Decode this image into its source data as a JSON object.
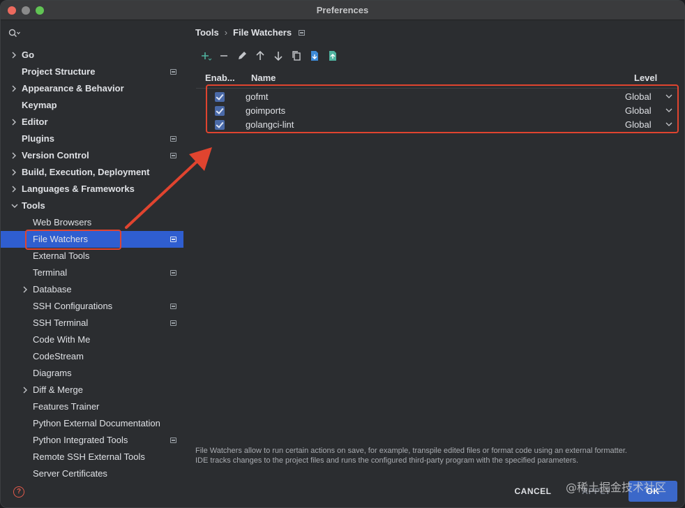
{
  "window": {
    "title": "Preferences"
  },
  "sidebar": {
    "search_placeholder": "",
    "items": [
      {
        "label": "Go",
        "bold": true,
        "level": 0,
        "expander": "right",
        "project": false
      },
      {
        "label": "Project Structure",
        "bold": true,
        "level": 0,
        "expander": "none",
        "project": true
      },
      {
        "label": "Appearance & Behavior",
        "bold": true,
        "level": 0,
        "expander": "right",
        "project": false
      },
      {
        "label": "Keymap",
        "bold": true,
        "level": 0,
        "expander": "none",
        "project": false
      },
      {
        "label": "Editor",
        "bold": true,
        "level": 0,
        "expander": "right",
        "project": false
      },
      {
        "label": "Plugins",
        "bold": true,
        "level": 0,
        "expander": "none",
        "project": true
      },
      {
        "label": "Version Control",
        "bold": true,
        "level": 0,
        "expander": "right",
        "project": true
      },
      {
        "label": "Build, Execution, Deployment",
        "bold": true,
        "level": 0,
        "expander": "right",
        "project": false
      },
      {
        "label": "Languages & Frameworks",
        "bold": true,
        "level": 0,
        "expander": "right",
        "project": false
      },
      {
        "label": "Tools",
        "bold": true,
        "level": 0,
        "expander": "down",
        "project": false
      },
      {
        "label": "Web Browsers",
        "bold": false,
        "level": 1,
        "expander": "none",
        "project": false
      },
      {
        "label": "File Watchers",
        "bold": false,
        "level": 1,
        "expander": "none",
        "project": true,
        "selected": true
      },
      {
        "label": "External Tools",
        "bold": false,
        "level": 1,
        "expander": "none",
        "project": false
      },
      {
        "label": "Terminal",
        "bold": false,
        "level": 1,
        "expander": "none",
        "project": true
      },
      {
        "label": "Database",
        "bold": false,
        "level": 1,
        "expander": "right",
        "project": false
      },
      {
        "label": "SSH Configurations",
        "bold": false,
        "level": 1,
        "expander": "none",
        "project": true
      },
      {
        "label": "SSH Terminal",
        "bold": false,
        "level": 1,
        "expander": "none",
        "project": true
      },
      {
        "label": "Code With Me",
        "bold": false,
        "level": 1,
        "expander": "none",
        "project": false
      },
      {
        "label": "CodeStream",
        "bold": false,
        "level": 1,
        "expander": "none",
        "project": false
      },
      {
        "label": "Diagrams",
        "bold": false,
        "level": 1,
        "expander": "none",
        "project": false
      },
      {
        "label": "Diff & Merge",
        "bold": false,
        "level": 1,
        "expander": "right",
        "project": false
      },
      {
        "label": "Features Trainer",
        "bold": false,
        "level": 1,
        "expander": "none",
        "project": false
      },
      {
        "label": "Python External Documentation",
        "bold": false,
        "level": 1,
        "expander": "none",
        "project": false
      },
      {
        "label": "Python Integrated Tools",
        "bold": false,
        "level": 1,
        "expander": "none",
        "project": true
      },
      {
        "label": "Remote SSH External Tools",
        "bold": false,
        "level": 1,
        "expander": "none",
        "project": false
      },
      {
        "label": "Server Certificates",
        "bold": false,
        "level": 1,
        "expander": "none",
        "project": false
      }
    ]
  },
  "breadcrumb": {
    "parent": "Tools",
    "separator": "›",
    "current": "File Watchers"
  },
  "toolbar": {
    "icons": [
      "add-icon",
      "remove-icon",
      "edit-icon",
      "move-up-icon",
      "move-down-icon",
      "copy-icon",
      "import-icon",
      "export-icon"
    ]
  },
  "table": {
    "headers": {
      "enabled": "Enab...",
      "name": "Name",
      "level": "Level"
    },
    "rows": [
      {
        "enabled": true,
        "name": "gofmt",
        "level": "Global"
      },
      {
        "enabled": true,
        "name": "goimports",
        "level": "Global"
      },
      {
        "enabled": true,
        "name": "golangci-lint",
        "level": "Global"
      }
    ]
  },
  "description": {
    "line1": "File Watchers allow to run certain actions on save, for example, transpile edited files or format code using an external formatter.",
    "line2": "IDE tracks changes to the project files and runs the configured third-party program with the specified parameters."
  },
  "buttons": {
    "cancel": "CANCEL",
    "apply": "APPLY",
    "ok": "OK"
  },
  "watermark": "@稀土掘金技术社区",
  "colors": {
    "accent": "#2f5ed0",
    "annotation": "#e0442f",
    "background": "#2b2d30"
  }
}
